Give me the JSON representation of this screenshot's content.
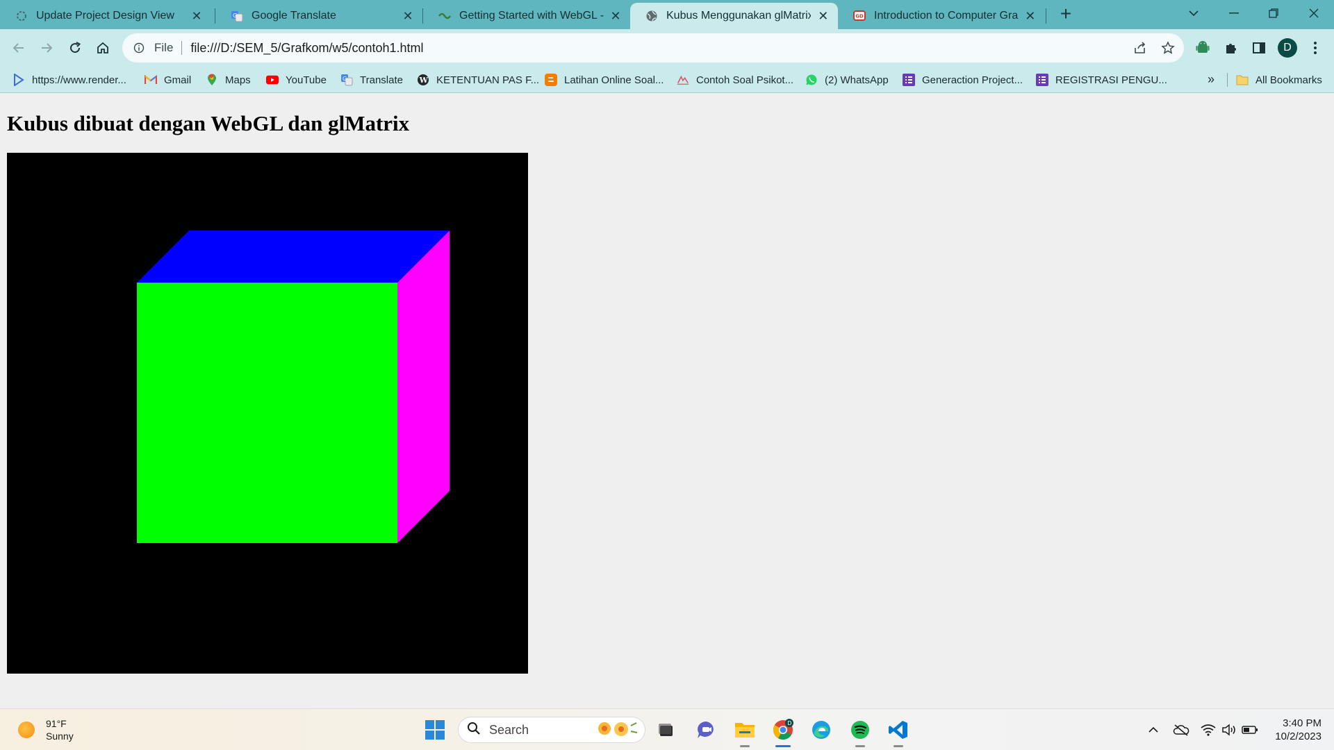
{
  "browser": {
    "tabs": [
      {
        "title": "Update Project Design View",
        "icon": "gear-loading-icon",
        "active": false
      },
      {
        "title": "Google Translate",
        "icon": "google-translate-icon",
        "active": false
      },
      {
        "title": "Getting Started with WebGL - Gu",
        "icon": "webgl-icon",
        "active": false
      },
      {
        "title": "Kubus Menggunakan glMatrix d",
        "icon": "globe-icon",
        "active": true
      },
      {
        "title": "Introduction to Computer Graph",
        "icon": "slides-icon",
        "active": false
      }
    ],
    "address": {
      "scheme_label": "File",
      "url": "file:///D:/SEM_5/Grafkom/w5/contoh1.html"
    },
    "profile_initial": "D",
    "bookmarks": [
      {
        "label": "https://www.render...",
        "icon": "render-icon"
      },
      {
        "label": "Gmail",
        "icon": "gmail-icon"
      },
      {
        "label": "Maps",
        "icon": "maps-icon"
      },
      {
        "label": "YouTube",
        "icon": "youtube-icon"
      },
      {
        "label": "Translate",
        "icon": "translate-icon"
      },
      {
        "label": "KETENTUAN PAS F...",
        "icon": "wordpress-icon"
      },
      {
        "label": "Latihan Online Soal...",
        "icon": "blogger-icon"
      },
      {
        "label": "Contoh Soal Psikot...",
        "icon": "psikotes-icon"
      },
      {
        "label": "(2) WhatsApp",
        "icon": "whatsapp-icon"
      },
      {
        "label": "Generaction Project...",
        "icon": "forms-icon"
      },
      {
        "label": "REGISTRASI PENGU...",
        "icon": "forms-icon"
      }
    ],
    "bookmarks_overflow": "»",
    "all_bookmarks_label": "All Bookmarks"
  },
  "page": {
    "heading": "Kubus dibuat dengan WebGL dan glMatrix",
    "cube_colors": {
      "front": "#00ff00",
      "top": "#0000ff",
      "right": "#ff00ff",
      "background": "#000000"
    }
  },
  "taskbar": {
    "weather": {
      "temp": "91°F",
      "condition": "Sunny"
    },
    "search_label": "Search",
    "clock": {
      "time": "3:40 PM",
      "date": "10/2/2023"
    },
    "chrome_badge": "D"
  }
}
